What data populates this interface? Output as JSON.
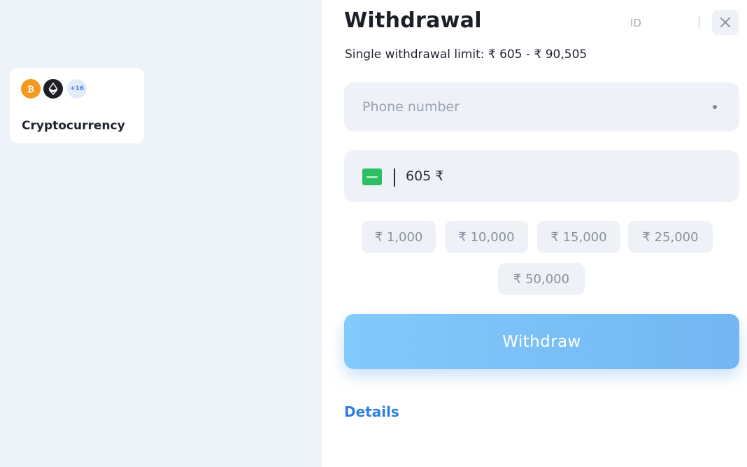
{
  "sidebar": {
    "methods": [
      {
        "label": "Cryptocurrency",
        "icons": [
          "bitcoin-icon",
          "ethereum-icon"
        ],
        "more_badge": "+16"
      }
    ]
  },
  "panel": {
    "title": "Withdrawal",
    "id_label": "ID",
    "limit_text": "Single withdrawal limit: ₹ 605 - ₹ 90,505",
    "phone_placeholder": "Phone number",
    "amount_value": "605 ₹",
    "quick_amounts": [
      "₹ 1,000",
      "₹ 10,000",
      "₹ 15,000",
      "₹ 25,000",
      "₹ 50,000"
    ],
    "submit_label": "Withdraw",
    "details_label": "Details"
  },
  "colors": {
    "accent": "#73b6f3",
    "link": "#2f7fd9",
    "bitcoin": "#f39a1e",
    "pay_icon": "#2dbd63"
  }
}
